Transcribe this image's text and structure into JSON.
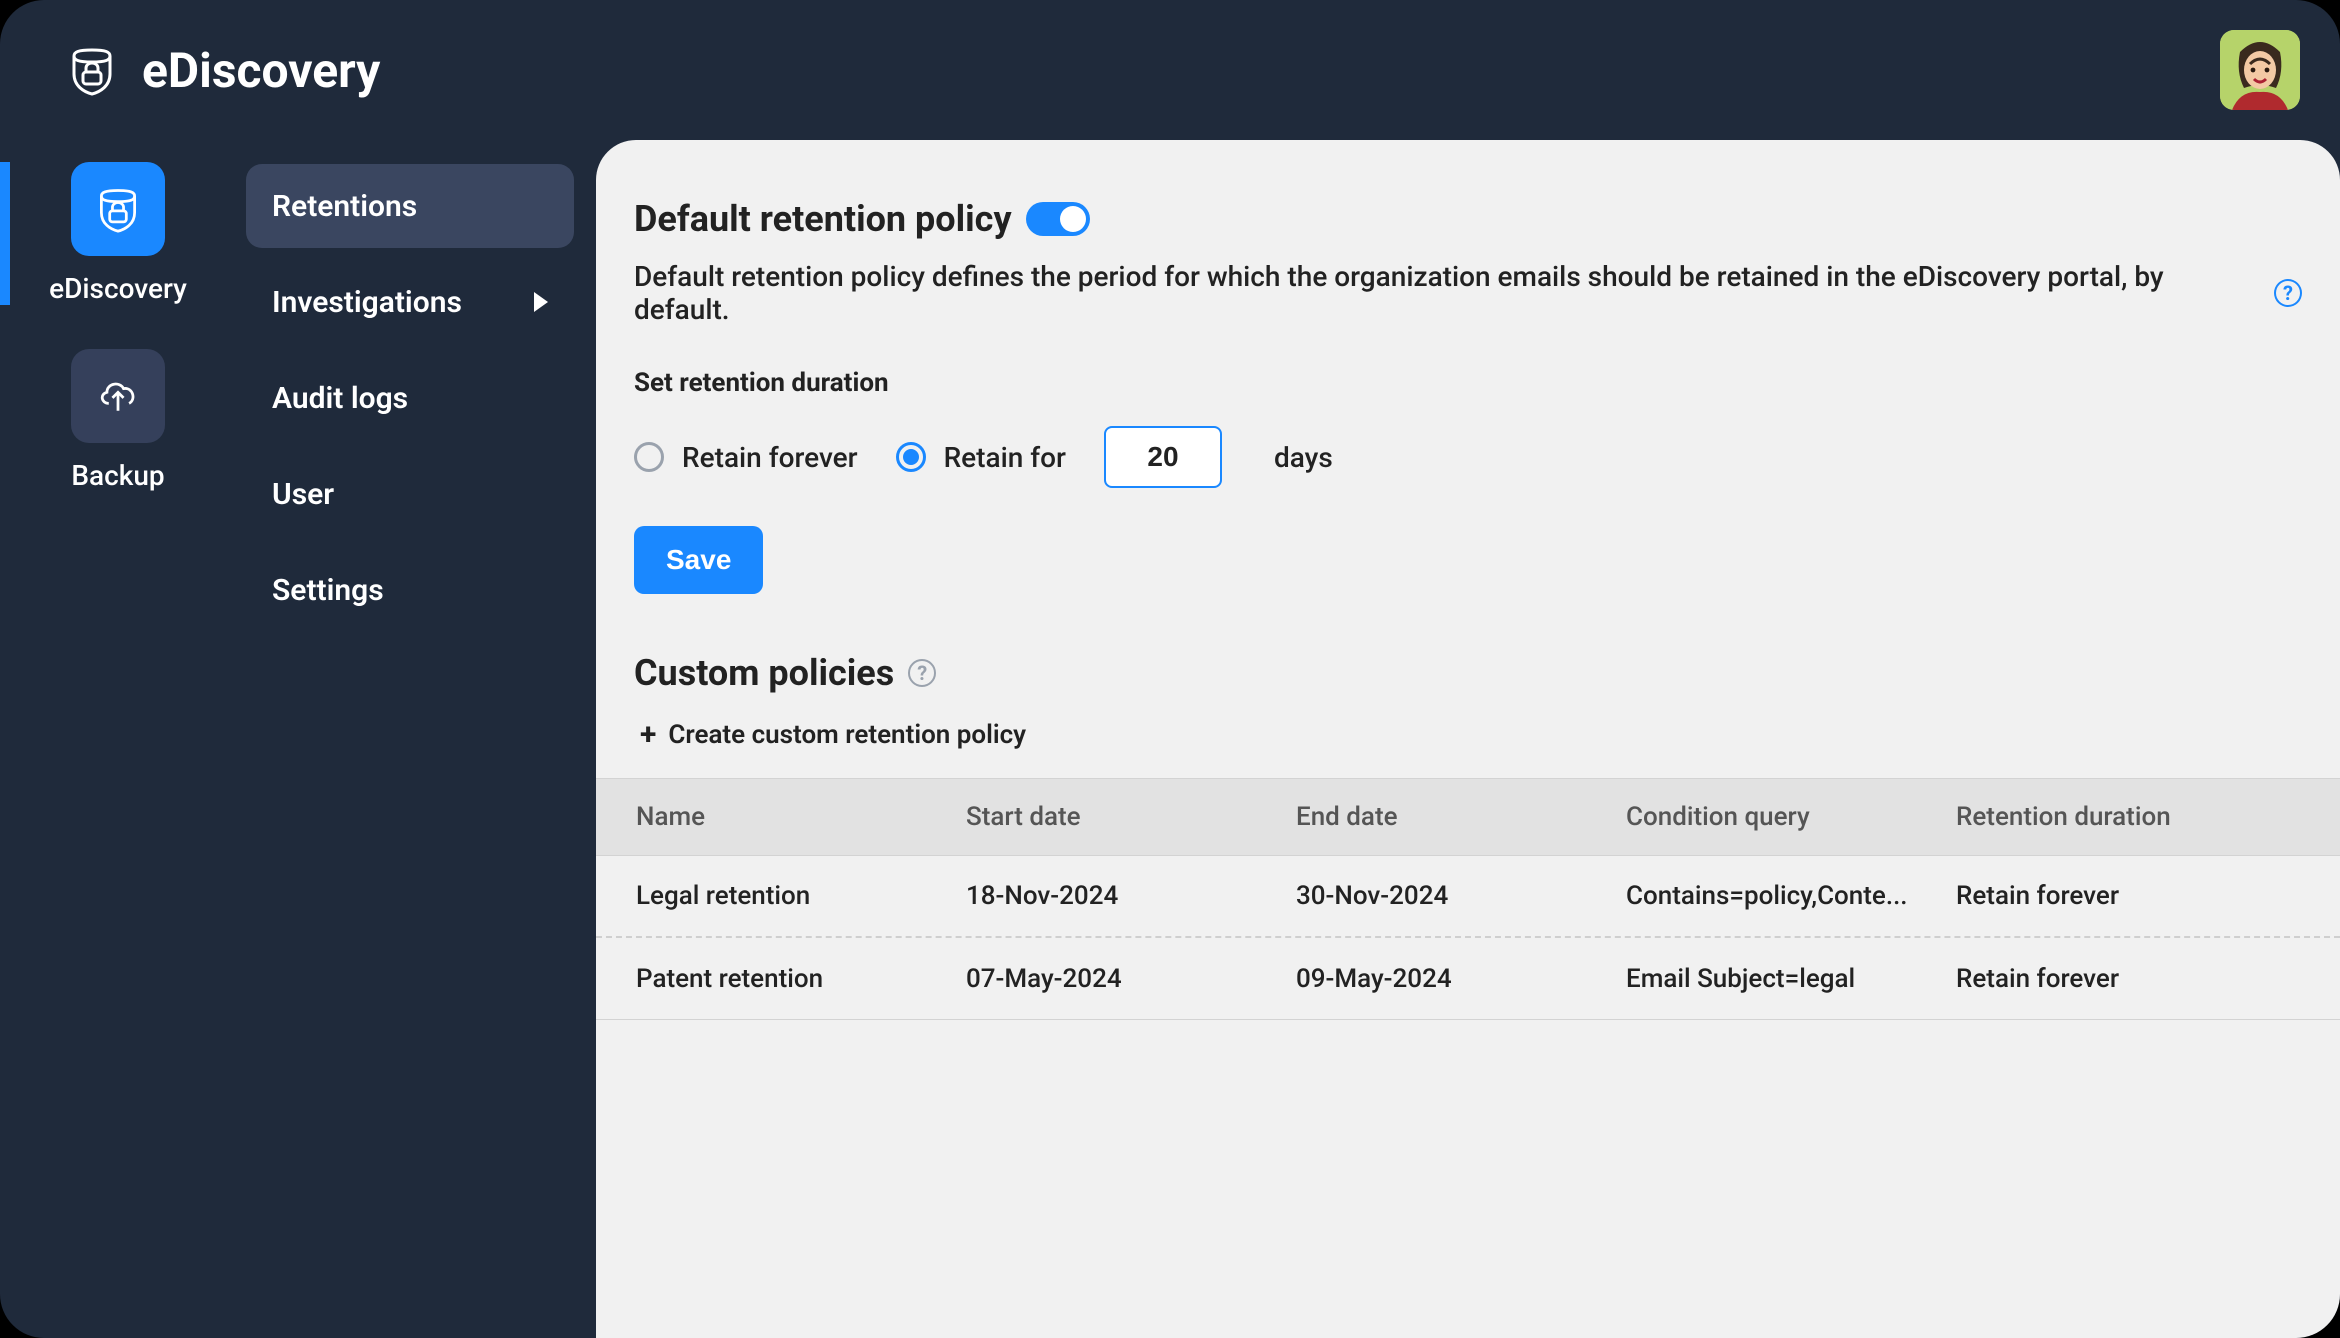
{
  "brand": {
    "name": "eDiscovery"
  },
  "rail": {
    "items": [
      {
        "label": "eDiscovery",
        "active": true
      },
      {
        "label": "Backup",
        "active": false
      }
    ]
  },
  "subnav": {
    "items": [
      {
        "label": "Retentions",
        "active": true,
        "has_submenu": false
      },
      {
        "label": "Investigations",
        "active": false,
        "has_submenu": true
      },
      {
        "label": "Audit logs",
        "active": false,
        "has_submenu": false
      },
      {
        "label": "User",
        "active": false,
        "has_submenu": false
      },
      {
        "label": "Settings",
        "active": false,
        "has_submenu": false
      }
    ]
  },
  "default_policy": {
    "title": "Default retention policy",
    "enabled": true,
    "description": "Default retention policy defines the period for which the organization emails should be retained in the eDiscovery portal, by default.",
    "duration_label": "Set retention duration",
    "options": {
      "forever_label": "Retain forever",
      "for_label": "Retain for",
      "days_value": "20",
      "days_unit": "days",
      "selected": "for"
    },
    "save_label": "Save"
  },
  "custom_policies": {
    "title": "Custom policies",
    "create_label": "Create custom retention policy",
    "columns": [
      "Name",
      "Start date",
      "End date",
      "Condition query",
      "Retention duration"
    ],
    "rows": [
      {
        "name": "Legal retention",
        "start": "18-Nov-2024",
        "end": "30-Nov-2024",
        "query": "Contains=policy,Conte...",
        "duration": "Retain forever"
      },
      {
        "name": "Patent retention",
        "start": "07-May-2024",
        "end": "09-May-2024",
        "query": "Email Subject=legal",
        "duration": "Retain forever"
      }
    ]
  },
  "colors": {
    "accent": "#1a88ff",
    "bg_dark": "#1f2a3b",
    "bg_light": "#f1f1f1"
  }
}
